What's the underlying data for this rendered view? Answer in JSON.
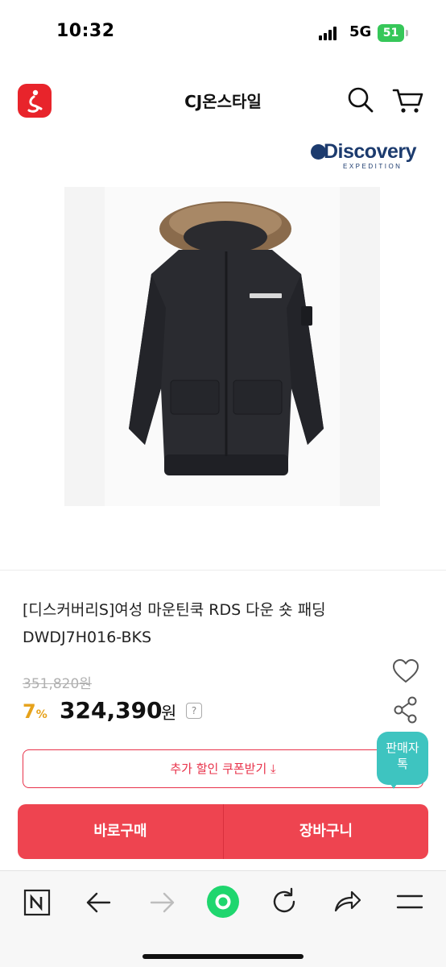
{
  "status_bar": {
    "time": "10:32",
    "network": "5G",
    "battery": "51"
  },
  "header": {
    "title": "CJ온스타일",
    "logo_icon": "cj-onstyle-logo",
    "search_icon": "search-icon",
    "cart_icon": "cart-icon"
  },
  "brand": {
    "name": "Discovery",
    "subtitle": "EXPEDITION"
  },
  "product": {
    "title": "[디스커버리S]여성 마운틴쿡 RDS 다운 숏 패딩 DWDJ7H016-BKS",
    "original_price": "351,820원",
    "discount_rate": "7",
    "discount_unit": "%",
    "sale_price": "324,390",
    "price_unit": "원",
    "help_label": "?"
  },
  "coupon": {
    "label": "추가 할인 쿠폰받기 ⤓"
  },
  "seller_chat": {
    "line1": "판매자",
    "line2": "톡"
  },
  "buy_bar": {
    "buy_now": "바로구매",
    "add_to_cart": "장바구니"
  },
  "colors": {
    "accent_red": "#ee4450",
    "logo_red": "#e8242b",
    "discount_orange": "#e6a21b",
    "chat_teal": "#3ec4c0",
    "brand_navy": "#1c3b6e",
    "browser_green": "#1fd66e"
  },
  "toolbar": {
    "icons": [
      "naver-n-icon",
      "back-arrow-icon",
      "forward-arrow-icon",
      "home-green-circle-icon",
      "refresh-icon",
      "share-icon",
      "menu-icon"
    ]
  }
}
